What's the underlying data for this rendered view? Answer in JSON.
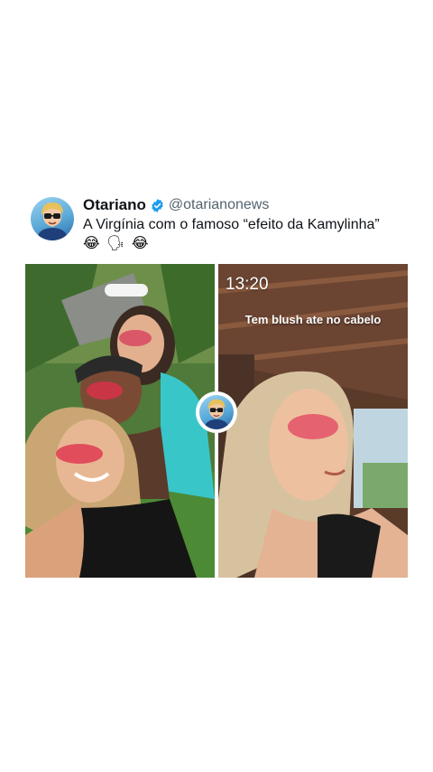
{
  "tweet": {
    "display_name": "Otariano",
    "handle": "@otarianonews",
    "verified": true,
    "text": "A Virgínia com o famoso “efeito da Kamylinha”",
    "emojis": [
      "😂",
      "🗣",
      "😂"
    ],
    "avatar_icon": "cartoon-avatar-icon"
  },
  "media": {
    "right_photo": {
      "story_time": "13:20",
      "caption": "Tem blush ate no cabelo"
    }
  },
  "colors": {
    "verified_blue": "#1d9bf0",
    "name_color": "#0f1419",
    "handle_color": "#536471"
  }
}
